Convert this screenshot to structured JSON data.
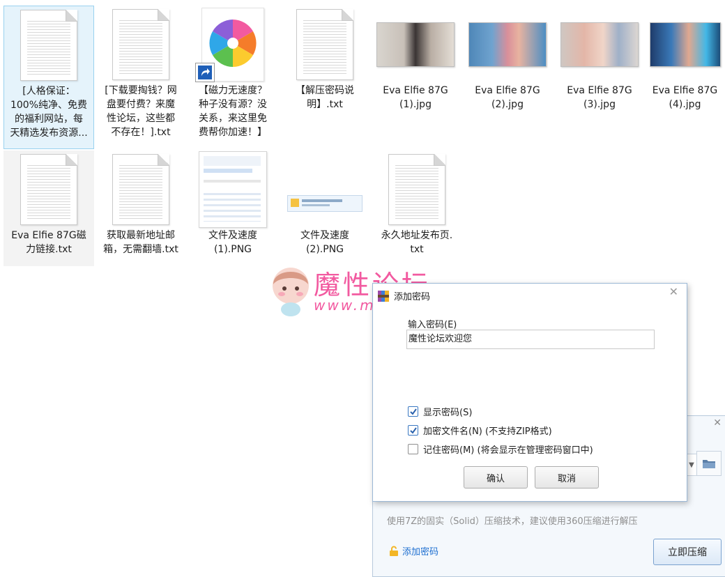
{
  "files": [
    {
      "name": "[人格保证：\n100%纯净、免费\n的福利网站，每\n天精选发布资源...",
      "type": "txt"
    },
    {
      "name": "[下载要掏钱？网\n盘要付费？来魔\n性论坛，这些都\n不存在！].txt",
      "type": "txt"
    },
    {
      "name": "【磁力无速度？\n种子没有源？没\n关系，来这里免\n费帮你加速！】",
      "type": "shortcut"
    },
    {
      "name": "【解压密码说\n明】.txt",
      "type": "txt"
    },
    {
      "name": "Eva Elfie 87G\n(1).jpg",
      "type": "jpg"
    },
    {
      "name": "Eva Elfie 87G\n(2).jpg",
      "type": "jpg"
    },
    {
      "name": "Eva Elfie 87G\n(3).jpg",
      "type": "jpg"
    },
    {
      "name": "Eva Elfie 87G\n(4).jpg",
      "type": "jpg"
    },
    {
      "name": "Eva Elfie 87G磁\n力链接.txt",
      "type": "txt"
    },
    {
      "name": "获取最新地址邮\n箱，无需翻墙.txt",
      "type": "txt"
    },
    {
      "name": "文件及速度\n(1).PNG",
      "type": "png"
    },
    {
      "name": "文件及速度\n(2).PNG",
      "type": "png"
    },
    {
      "name": "永久地址发布页.\ntxt",
      "type": "txt"
    }
  ],
  "watermark": {
    "title": "魔性论坛",
    "url": "www.moxing.cool"
  },
  "dialog": {
    "title": "添加密码",
    "field_label": "输入密码(E)",
    "password_value": "魔性论坛欢迎您",
    "show_password": {
      "label": "显示密码(S)",
      "checked": true
    },
    "encrypt_names": {
      "label": "加密文件名(N) (不支持ZIP格式)",
      "checked": true
    },
    "remember": {
      "label": "记住密码(M) (将会显示在管理密码窗口中)",
      "checked": false
    },
    "ok_label": "确认",
    "cancel_label": "取消",
    "close_glyph": "✕"
  },
  "back_dialog": {
    "info": "使用7Z的固实（Solid）压缩技术，建议使用360压缩进行解压",
    "add_password_link": "添加密码",
    "compress_label": "立即压缩",
    "close_glyph": "✕"
  },
  "colors": {
    "accent": "#1e6fd0",
    "watermark": "#f25aa0",
    "selection": "#e5f3fb"
  }
}
